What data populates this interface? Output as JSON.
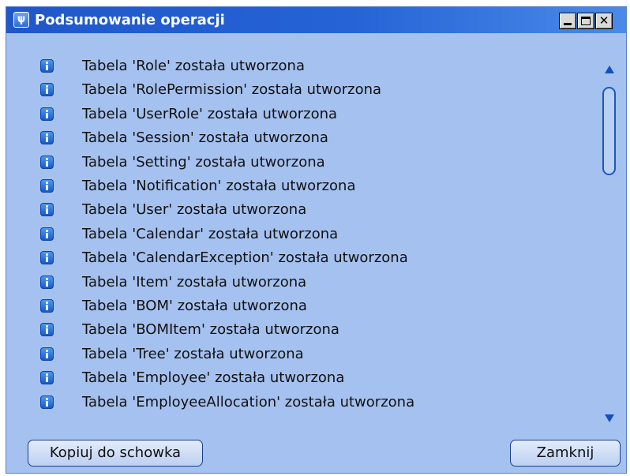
{
  "window": {
    "title": "Podsumowanie operacji",
    "icon": "app-icon",
    "controls": {
      "minimize_glyph": "_",
      "maximize_glyph": "□",
      "close_glyph": "✕"
    }
  },
  "list": {
    "items": [
      {
        "icon": "info-icon",
        "text": "Tabela 'Role' została utworzona"
      },
      {
        "icon": "info-icon",
        "text": "Tabela 'RolePermission' została utworzona"
      },
      {
        "icon": "info-icon",
        "text": "Tabela 'UserRole' została utworzona"
      },
      {
        "icon": "info-icon",
        "text": "Tabela 'Session' została utworzona"
      },
      {
        "icon": "info-icon",
        "text": "Tabela 'Setting' została utworzona"
      },
      {
        "icon": "info-icon",
        "text": "Tabela 'Notification' została utworzona"
      },
      {
        "icon": "info-icon",
        "text": "Tabela 'User' została utworzona"
      },
      {
        "icon": "info-icon",
        "text": "Tabela 'Calendar' została utworzona"
      },
      {
        "icon": "info-icon",
        "text": "Tabela 'CalendarException' została utworzona"
      },
      {
        "icon": "info-icon",
        "text": "Tabela 'Item' została utworzona"
      },
      {
        "icon": "info-icon",
        "text": "Tabela 'BOM' została utworzona"
      },
      {
        "icon": "info-icon",
        "text": "Tabela 'BOMItem' została utworzona"
      },
      {
        "icon": "info-icon",
        "text": "Tabela 'Tree' została utworzona"
      },
      {
        "icon": "info-icon",
        "text": "Tabela 'Employee' została utworzona"
      },
      {
        "icon": "info-icon",
        "text": "Tabela 'EmployeeAllocation' została utworzona"
      }
    ]
  },
  "buttons": {
    "copy_label": "Kopiuj do schowka",
    "close_label": "Zamknij"
  },
  "colors": {
    "titlebar": "#2563d6",
    "body": "#a5c1ef",
    "accent": "#1450b8"
  }
}
